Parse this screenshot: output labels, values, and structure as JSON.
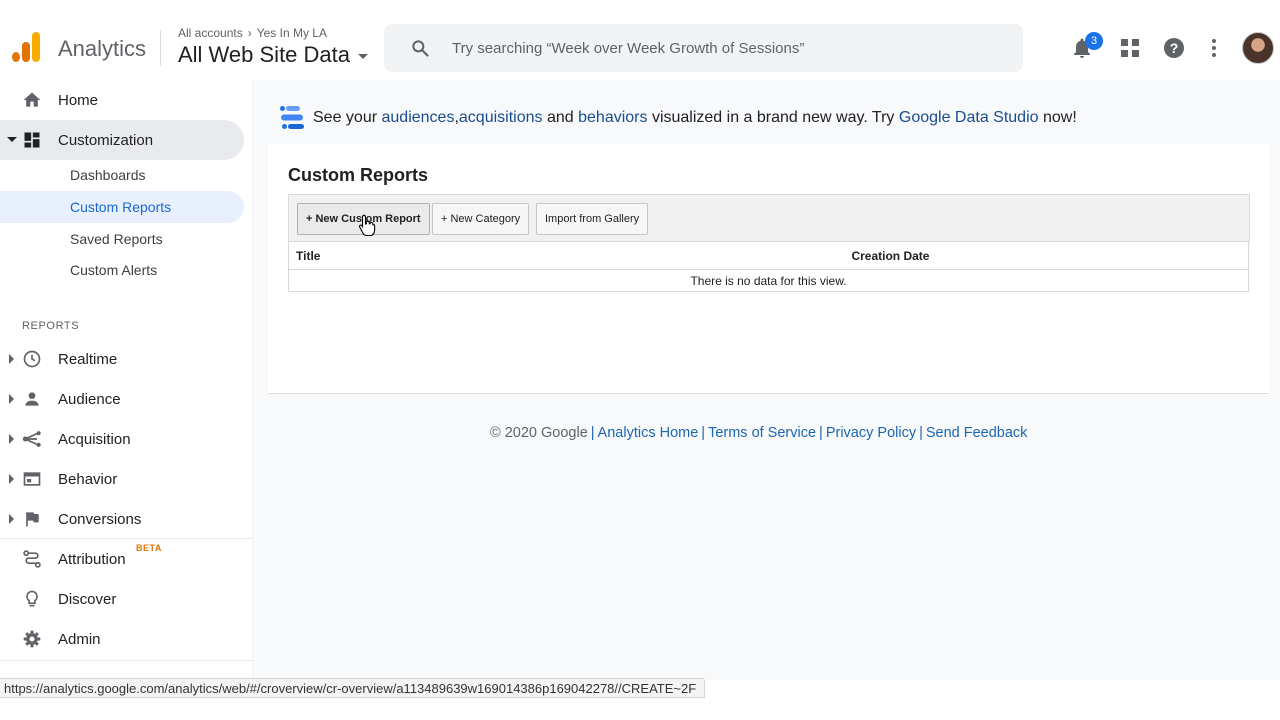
{
  "header": {
    "app_name": "Analytics",
    "breadcrumb_account": "All accounts",
    "breadcrumb_property": "Yes In My LA",
    "view_name": "All Web Site Data",
    "search_placeholder": "Try searching “Week over Week Growth of Sessions”",
    "notification_count": "3"
  },
  "sidebar": {
    "home": "Home",
    "customization": "Customization",
    "sub_items": [
      "Dashboards",
      "Custom Reports",
      "Saved Reports",
      "Custom Alerts"
    ],
    "reports_section": "REPORTS",
    "reports": [
      "Realtime",
      "Audience",
      "Acquisition",
      "Behavior",
      "Conversions"
    ],
    "attribution": "Attribution",
    "beta": "BETA",
    "discover": "Discover",
    "admin": "Admin"
  },
  "promo": {
    "p1": "See your ",
    "audiences": "audiences",
    "comma": ", ",
    "acquisitions": "acquisitions",
    "and": " and ",
    "behaviors": "behaviors",
    "p2": " visualized in a brand new way. Try ",
    "data_studio": "Google Data Studio",
    "p3": " now!"
  },
  "main": {
    "title": "Custom Reports",
    "buttons": {
      "new_report": "+ New Custom Report",
      "new_category": "+ New Category",
      "import_gallery": "Import from Gallery"
    },
    "table": {
      "col_title": "Title",
      "col_date": "Creation Date",
      "empty": "There is no data for this view."
    }
  },
  "footer": {
    "copyright": "© 2020 Google",
    "links": [
      "Analytics Home",
      "Terms of Service",
      "Privacy Policy",
      "Send Feedback"
    ]
  },
  "status_url": "https://analytics.google.com/analytics/web/#/croverview/cr-overview/a113489639w169014386p169042278//CREATE~2F",
  "colors": {
    "accent": "#1a73e8",
    "link": "#1a4d8f",
    "logo_orange": "#e37400",
    "logo_yellow": "#f9ab00"
  }
}
